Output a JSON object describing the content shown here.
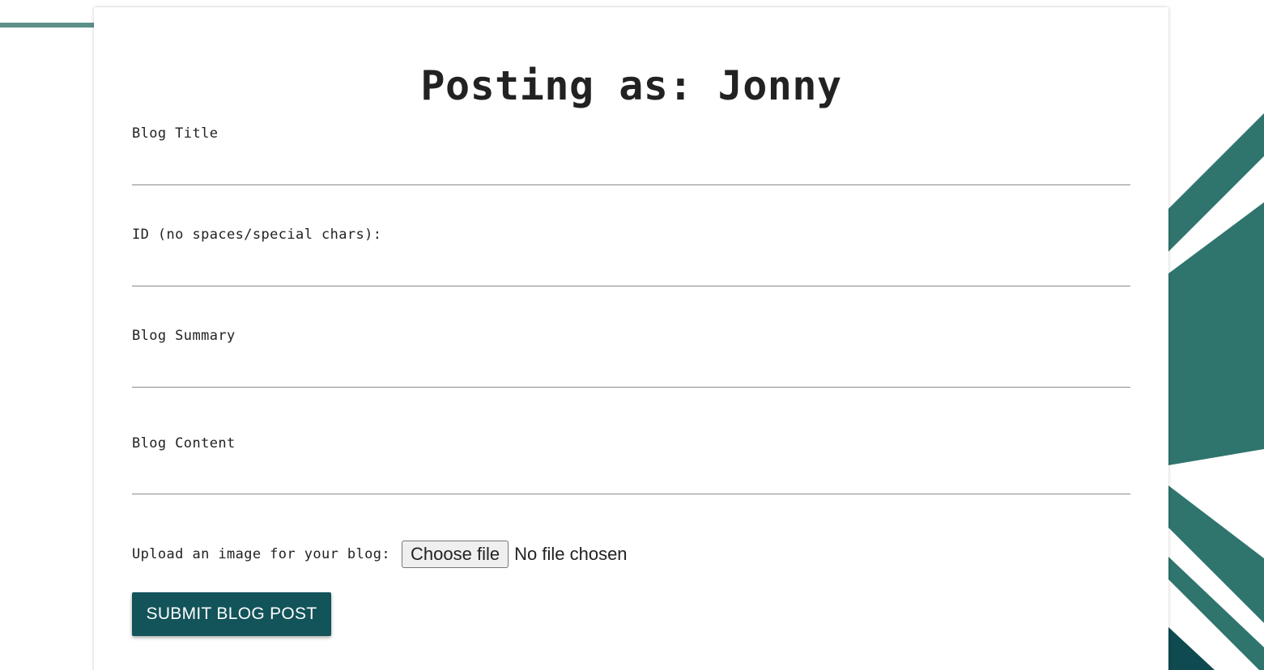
{
  "form": {
    "heading": "Posting as: Jonny",
    "fields": [
      {
        "label": "Blog Title",
        "value": ""
      },
      {
        "label": "ID (no spaces/special chars):",
        "value": ""
      },
      {
        "label": "Blog Summary",
        "value": ""
      },
      {
        "label": "Blog Content",
        "value": ""
      }
    ],
    "upload": {
      "label": "Upload an image for your blog:",
      "button_label": "Choose file",
      "status": "No file chosen"
    },
    "submit_label": "SUBMIT BLOG POST"
  },
  "colors": {
    "accent": "#13535a",
    "decoration": "#2f756d",
    "decoration_dark": "#0e4a4f",
    "decoration_line": "#5b8f8a",
    "input_underline": "#8a8a8a",
    "text": "#222222"
  }
}
